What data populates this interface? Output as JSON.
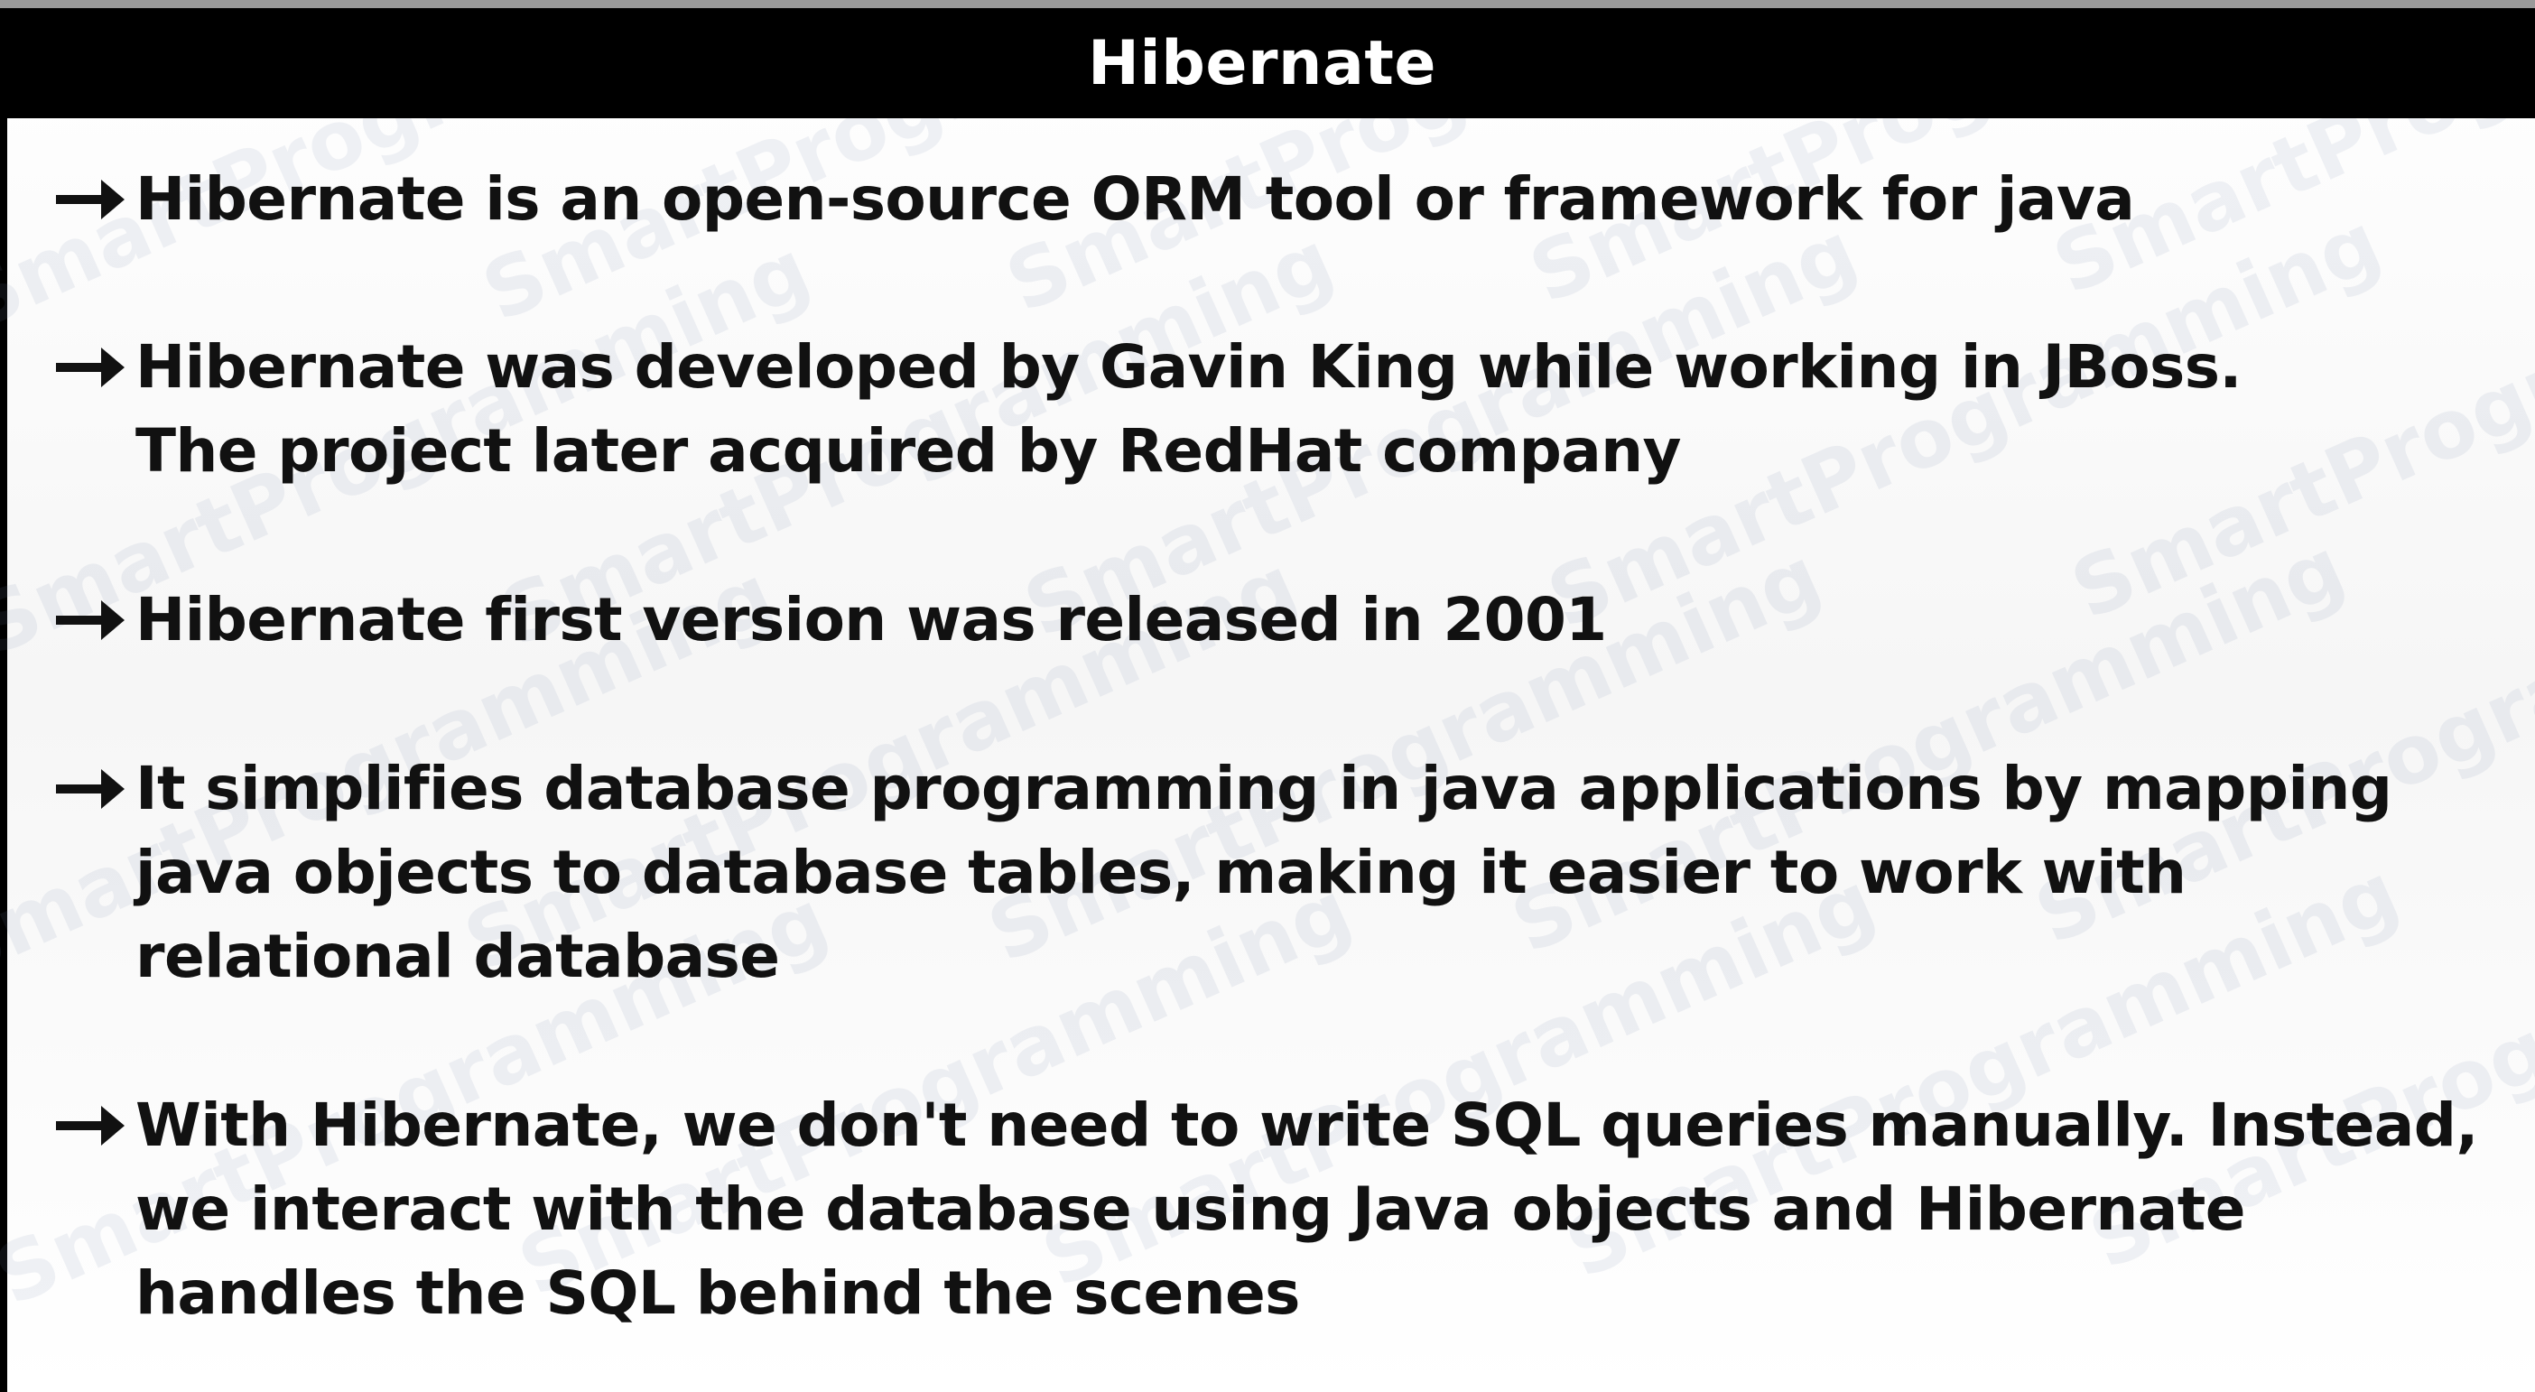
{
  "title": "Hibernate",
  "watermark": {
    "text": "SmartProgramming"
  },
  "bullets": [
    {
      "lines": [
        "Hibernate is an open-source ORM tool or framework for java"
      ]
    },
    {
      "lines": [
        "Hibernate was developed by Gavin King while working in JBoss.",
        "The project later acquired by RedHat company"
      ]
    },
    {
      "lines": [
        "Hibernate first version was released in 2001"
      ]
    },
    {
      "lines": [
        "It simplifies database programming in java applications by mapping",
        "java objects to database tables, making it easier to work with",
        "relational database"
      ]
    },
    {
      "lines": [
        "With Hibernate, we don't need to write SQL queries manually. Instead,",
        "we interact with the database using Java objects and Hibernate",
        "handles the SQL behind the scenes"
      ]
    }
  ],
  "colors": {
    "title_bar": "#000000",
    "title_text": "#ffffff",
    "body_text": "#111111",
    "background": "#ffffff"
  }
}
